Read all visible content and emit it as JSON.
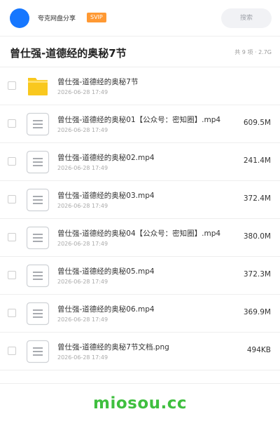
{
  "app": {
    "title": "夸克网盘分享",
    "badge": "SVIP",
    "search_label": "搜索",
    "avatar_color": "#1677ff"
  },
  "folder": {
    "title": "曾仕强-道德经的奥秘7节",
    "meta": "共 9 项 · 2.7G"
  },
  "files": [
    {
      "name": "曾仕强-道德经的奥秘7节",
      "date": "2026-06-28 17:49",
      "size": "",
      "icon": "folder-icon"
    },
    {
      "name": "曾仕强-道德经的奥秘01【公众号：密知圈】.mp4",
      "date": "2026-06-28 17:49",
      "size": "609.5M",
      "icon": "document-icon"
    },
    {
      "name": "曾仕强-道德经的奥秘02.mp4",
      "date": "2026-06-28 17:49",
      "size": "241.4M",
      "icon": "document-icon"
    },
    {
      "name": "曾仕强-道德经的奥秘03.mp4",
      "date": "2026-06-28 17:49",
      "size": "372.4M",
      "icon": "document-icon"
    },
    {
      "name": "曾仕强-道德经的奥秘04【公众号：密知圈】.mp4",
      "date": "2026-06-28 17:49",
      "size": "380.0M",
      "icon": "document-icon"
    },
    {
      "name": "曾仕强-道德经的奥秘05.mp4",
      "date": "2026-06-28 17:49",
      "size": "372.3M",
      "icon": "document-icon"
    },
    {
      "name": "曾仕强-道德经的奥秘06.mp4",
      "date": "2026-06-28 17:49",
      "size": "369.9M",
      "icon": "document-icon"
    },
    {
      "name": "曾仕强-道德经的奥秘7节文档.png",
      "date": "2026-06-28 17:49",
      "size": "494KB",
      "icon": "document-icon"
    }
  ],
  "watermark": "miosou.cc",
  "colors": {
    "accent": "#1677ff",
    "badge": "#ff9933",
    "folder": "#f9c81e",
    "watermark": "#3fbf3f"
  }
}
